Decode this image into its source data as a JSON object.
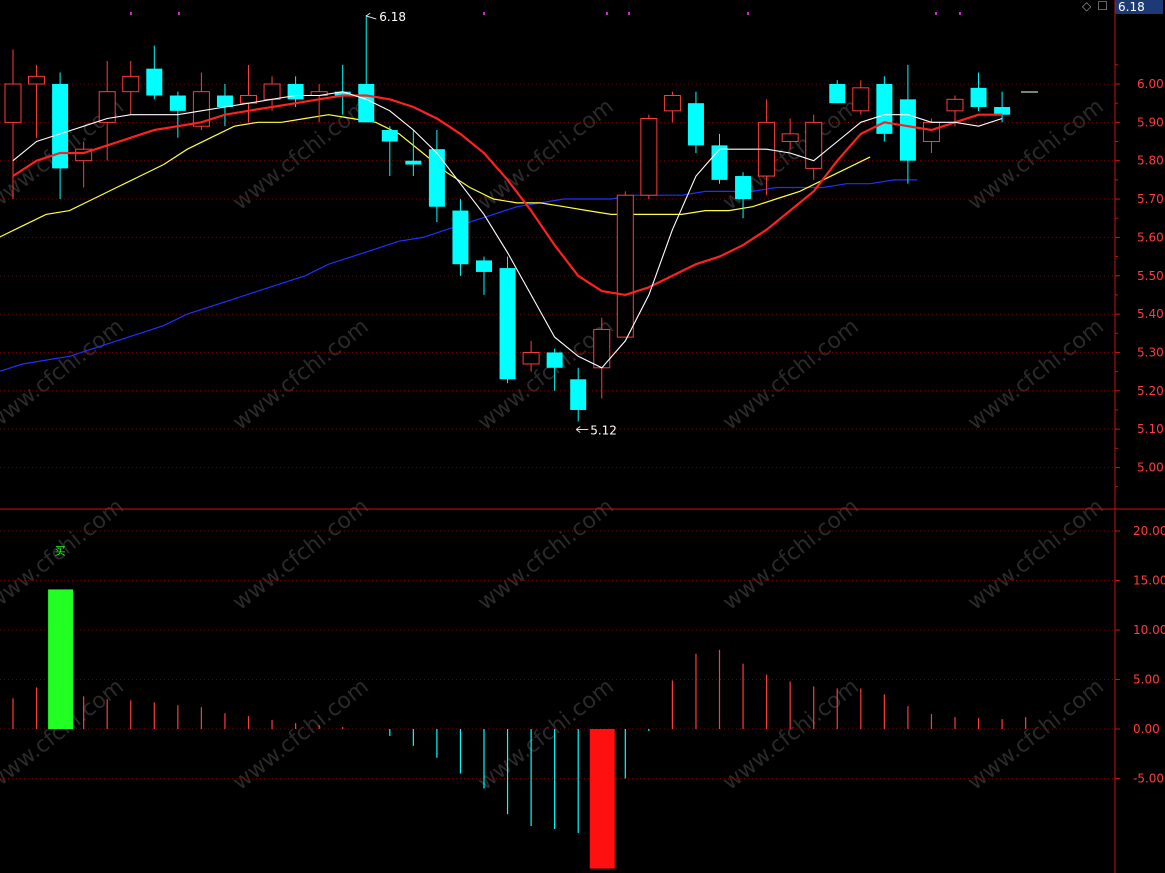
{
  "header": {
    "last_price": "6.18",
    "icons": [
      "diamond-outline-icon",
      "checkbox-icon"
    ]
  },
  "colors": {
    "background": "#000000",
    "axis_red": "#c81010",
    "grid_red": "#7a0000",
    "up_candle": "#ff3b3b",
    "down_candle": "#00ffff",
    "ma5": "#ffffff",
    "ma10": "#ff2020",
    "ma20": "#ffff40",
    "ma60": "#2030ff",
    "axis_text": "#ff3b3b",
    "buy_bar": "#22ff22",
    "sell_bar": "#ff1010",
    "marker_magenta": "#c030c0"
  },
  "chart_data": [
    {
      "type": "candlestick",
      "title": "",
      "price_axis": {
        "ticks": [
          "6.00",
          "5.90",
          "5.80",
          "5.70",
          "5.60",
          "5.50",
          "5.40",
          "5.30",
          "5.20",
          "5.10",
          "5.00"
        ],
        "range": [
          4.89,
          6.28
        ]
      },
      "annotations": {
        "high": "6.18",
        "low": "5.12"
      },
      "candles": [
        {
          "o": 5.9,
          "c": 6.0,
          "h": 6.09,
          "l": 5.7
        },
        {
          "o": 6.0,
          "c": 6.02,
          "h": 6.05,
          "l": 5.86
        },
        {
          "o": 6.0,
          "c": 5.78,
          "h": 6.03,
          "l": 5.7
        },
        {
          "o": 5.8,
          "c": 5.83,
          "h": 5.85,
          "l": 5.73
        },
        {
          "o": 5.9,
          "c": 5.98,
          "h": 6.06,
          "l": 5.8
        },
        {
          "o": 5.98,
          "c": 6.02,
          "h": 6.06,
          "l": 5.92
        },
        {
          "o": 6.04,
          "c": 5.97,
          "h": 6.1,
          "l": 5.96
        },
        {
          "o": 5.97,
          "c": 5.93,
          "h": 5.98,
          "l": 5.86
        },
        {
          "o": 5.89,
          "c": 5.98,
          "h": 6.03,
          "l": 5.88
        },
        {
          "o": 5.97,
          "c": 5.94,
          "h": 6.0,
          "l": 5.89
        },
        {
          "o": 5.95,
          "c": 5.97,
          "h": 6.05,
          "l": 5.9
        },
        {
          "o": 5.96,
          "c": 6.0,
          "h": 6.02,
          "l": 5.93
        },
        {
          "o": 6.0,
          "c": 5.96,
          "h": 6.02,
          "l": 5.94
        },
        {
          "o": 5.97,
          "c": 5.98,
          "h": 6.0,
          "l": 5.9
        },
        {
          "o": 5.98,
          "c": 5.97,
          "h": 6.05,
          "l": 5.92
        },
        {
          "o": 6.0,
          "c": 5.9,
          "h": 6.18,
          "l": 5.9
        },
        {
          "o": 5.88,
          "c": 5.85,
          "h": 5.89,
          "l": 5.76
        },
        {
          "o": 5.8,
          "c": 5.79,
          "h": 5.88,
          "l": 5.76
        },
        {
          "o": 5.83,
          "c": 5.68,
          "h": 5.88,
          "l": 5.64
        },
        {
          "o": 5.67,
          "c": 5.53,
          "h": 5.7,
          "l": 5.5
        },
        {
          "o": 5.54,
          "c": 5.51,
          "h": 5.55,
          "l": 5.45
        },
        {
          "o": 5.52,
          "c": 5.23,
          "h": 5.55,
          "l": 5.22
        },
        {
          "o": 5.27,
          "c": 5.3,
          "h": 5.33,
          "l": 5.25
        },
        {
          "o": 5.3,
          "c": 5.26,
          "h": 5.31,
          "l": 5.2
        },
        {
          "o": 5.23,
          "c": 5.15,
          "h": 5.26,
          "l": 5.12
        },
        {
          "o": 5.26,
          "c": 5.36,
          "h": 5.39,
          "l": 5.18
        },
        {
          "o": 5.34,
          "c": 5.71,
          "h": 5.72,
          "l": 5.34
        },
        {
          "o": 5.71,
          "c": 5.91,
          "h": 5.92,
          "l": 5.7
        },
        {
          "o": 5.93,
          "c": 5.97,
          "h": 5.98,
          "l": 5.9
        },
        {
          "o": 5.95,
          "c": 5.84,
          "h": 5.98,
          "l": 5.82
        },
        {
          "o": 5.84,
          "c": 5.75,
          "h": 5.87,
          "l": 5.74
        },
        {
          "o": 5.76,
          "c": 5.7,
          "h": 5.77,
          "l": 5.65
        },
        {
          "o": 5.76,
          "c": 5.9,
          "h": 5.96,
          "l": 5.71
        },
        {
          "o": 5.85,
          "c": 5.87,
          "h": 5.91,
          "l": 5.83
        },
        {
          "o": 5.78,
          "c": 5.9,
          "h": 5.92,
          "l": 5.75
        },
        {
          "o": 6.0,
          "c": 5.95,
          "h": 6.01,
          "l": 5.95
        },
        {
          "o": 5.93,
          "c": 5.99,
          "h": 6.01,
          "l": 5.92
        },
        {
          "o": 6.0,
          "c": 5.87,
          "h": 6.02,
          "l": 5.85
        },
        {
          "o": 5.96,
          "c": 5.8,
          "h": 6.05,
          "l": 5.74
        },
        {
          "o": 5.85,
          "c": 5.9,
          "h": 5.91,
          "l": 5.82
        },
        {
          "o": 5.93,
          "c": 5.96,
          "h": 5.97,
          "l": 5.89
        },
        {
          "o": 5.99,
          "c": 5.94,
          "h": 6.03,
          "l": 5.93
        },
        {
          "o": 5.94,
          "c": 5.92,
          "h": 5.98,
          "l": 5.9
        }
      ],
      "moving_averages": {
        "ma5": [
          5.8,
          5.85,
          5.87,
          5.89,
          5.91,
          5.92,
          5.92,
          5.92,
          5.93,
          5.94,
          5.95,
          5.96,
          5.97,
          5.97,
          5.98,
          5.96,
          5.93,
          5.88,
          5.82,
          5.74,
          5.66,
          5.56,
          5.45,
          5.34,
          5.29,
          5.26,
          5.33,
          5.45,
          5.62,
          5.76,
          5.83,
          5.83,
          5.83,
          5.82,
          5.8,
          5.85,
          5.9,
          5.92,
          5.92,
          5.9,
          5.9,
          5.89,
          5.91
        ],
        "ma10": [
          5.76,
          5.8,
          5.82,
          5.82,
          5.84,
          5.86,
          5.88,
          5.89,
          5.9,
          5.92,
          5.93,
          5.94,
          5.95,
          5.96,
          5.97,
          5.97,
          5.96,
          5.94,
          5.91,
          5.87,
          5.82,
          5.75,
          5.67,
          5.58,
          5.5,
          5.46,
          5.45,
          5.47,
          5.5,
          5.53,
          5.55,
          5.58,
          5.62,
          5.67,
          5.72,
          5.8,
          5.87,
          5.9,
          5.89,
          5.88,
          5.9,
          5.92,
          5.92
        ],
        "ma20": [
          5.6,
          5.63,
          5.66,
          5.67,
          5.7,
          5.73,
          5.76,
          5.79,
          5.83,
          5.86,
          5.89,
          5.9,
          5.9,
          5.91,
          5.92,
          5.91,
          5.9,
          5.87,
          5.82,
          5.77,
          5.73,
          5.7,
          5.69,
          5.69,
          5.68,
          5.67,
          5.66,
          5.66,
          5.66,
          5.66,
          5.67,
          5.67,
          5.68,
          5.7,
          5.72,
          5.75,
          5.78,
          5.81
        ],
        "ma60": [
          5.25,
          5.27,
          5.28,
          5.29,
          5.31,
          5.33,
          5.35,
          5.37,
          5.4,
          5.42,
          5.44,
          5.46,
          5.48,
          5.5,
          5.53,
          5.55,
          5.57,
          5.59,
          5.6,
          5.62,
          5.64,
          5.66,
          5.68,
          5.69,
          5.7,
          5.7,
          5.7,
          5.71,
          5.71,
          5.71,
          5.72,
          5.72,
          5.72,
          5.73,
          5.73,
          5.73,
          5.74,
          5.74,
          5.75,
          5.75
        ]
      },
      "markers": [
        "magenta-tick",
        "magenta-tick",
        "magenta-tick",
        "magenta-tick",
        "magenta-tick",
        "magenta-tick",
        "magenta-tick",
        "magenta-tick"
      ]
    },
    {
      "type": "bar",
      "title": "",
      "axis": {
        "ticks": [
          "20.00",
          "15.00",
          "10.00",
          "5.00",
          "0.00",
          "-5.00"
        ],
        "range": [
          -14.2,
          22.0
        ]
      },
      "values": [
        3.1,
        4.2,
        14.1,
        3.3,
        3.0,
        2.9,
        2.7,
        2.4,
        2.2,
        1.6,
        1.3,
        0.9,
        0.6,
        0.4,
        0.2,
        0,
        -0.7,
        -1.7,
        -2.9,
        -4.5,
        -6.0,
        -8.6,
        -9.8,
        -10.1,
        -10.5,
        -14.1,
        -5.0,
        -0.2,
        4.9,
        7.6,
        8.0,
        6.6,
        5.5,
        4.8,
        4.3,
        4.1,
        4.1,
        3.5,
        2.3,
        1.5,
        1.2,
        1.1,
        1.0,
        1.2
      ],
      "signals": {
        "buy_index": 2,
        "sell_index": 25,
        "buy_label": "买"
      }
    }
  ],
  "watermark": "www.cfchi.com"
}
